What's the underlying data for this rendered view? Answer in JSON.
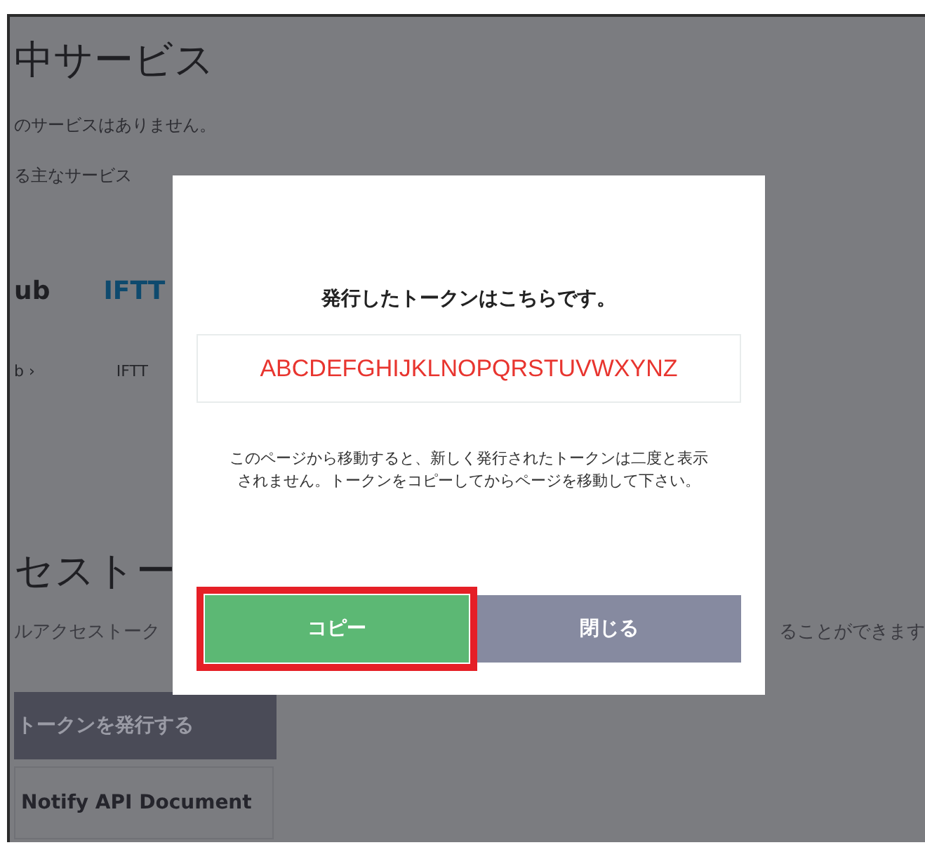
{
  "background_page": {
    "heading": "中サービス",
    "empty_message": "のサービスはありません。",
    "services_label": "る主なサービス",
    "service_logos": [
      {
        "label": "ub",
        "kind": "dark"
      },
      {
        "label": "IFTT",
        "kind": "blue"
      }
    ],
    "service_links": [
      "b ›",
      "IFTT"
    ],
    "token_heading": "セストー",
    "token_description": "ルアクセストーク",
    "token_description_end": "ることができます",
    "issue_button": "トークンを発行する",
    "doc_link": "Notify API Document"
  },
  "dialog": {
    "title": "発行したトークンはこちらです。",
    "token": "ABCDEFGHIJKLNOPQRSTUVWXYNZ",
    "note": "このページから移動すると、新しく発行されたトークンは二度と表示されません。トークンをコピーしてからページを移動して下さい。",
    "buttons": [
      {
        "label": "コピー",
        "kind": "primary",
        "highlighted": true
      },
      {
        "label": "閉じる",
        "kind": "secondary",
        "highlighted": false
      }
    ]
  }
}
